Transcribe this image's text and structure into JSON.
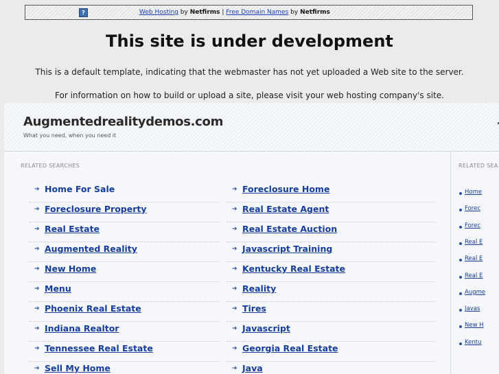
{
  "top_bar": {
    "link1": "Web Hosting",
    "by1": "by",
    "brand1": "Netfirms",
    "sep": "|",
    "link2": "Free Domain Names",
    "by2": "by",
    "brand2": "Netfirms"
  },
  "heading": "This site is under development",
  "message1": "This is a default template, indicating that the webmaster has not yet uploaded a Web site to the server.",
  "message2": "For information on how to build or upload a site, please visit your web hosting company's site.",
  "site": {
    "domain": "Augmentedrealitydemos.com",
    "tagline": "What you need, when you need it"
  },
  "left_panel": {
    "label": "RELATED SEARCHES",
    "col1": [
      "Home For Sale",
      "Foreclosure Property",
      "Real Estate",
      "Augmented Reality",
      "New Home",
      "Menu",
      "Phoenix Real Estate",
      "Indiana Realtor",
      "Tennessee Real Estate",
      "Sell My Home"
    ],
    "col2": [
      "Foreclosure Home",
      "Real Estate Agent",
      "Real Estate Auction",
      "Javascript Training",
      "Kentucky Real Estate",
      "Reality",
      "Tires",
      "Javascript",
      "Georgia Real Estate",
      "Java"
    ]
  },
  "right_panel": {
    "label": "RELATED SEA",
    "links": [
      "Home",
      "Forec",
      "Forec",
      "Real E",
      "Real E",
      "Real E",
      "Augme",
      "Javas",
      "New H",
      "Kentu"
    ]
  }
}
